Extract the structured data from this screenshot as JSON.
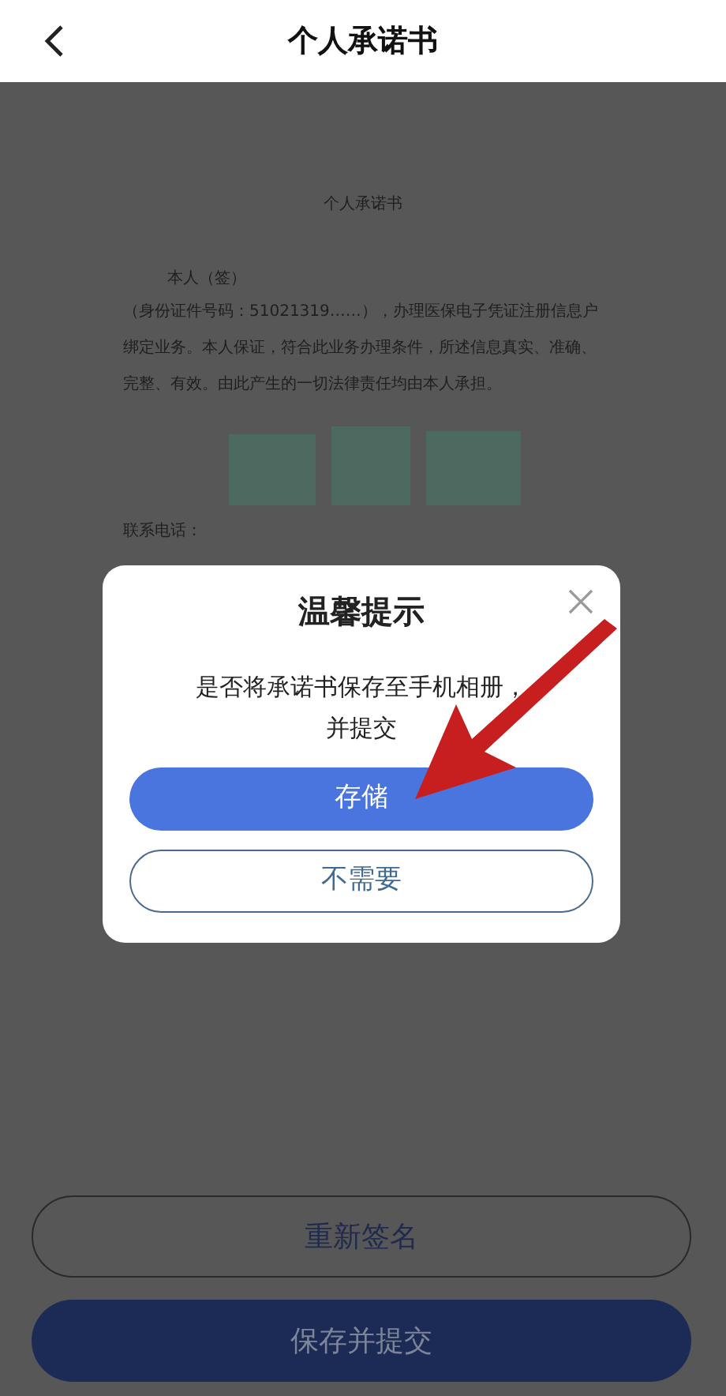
{
  "header": {
    "title": "个人承诺书"
  },
  "document": {
    "title": "个人承诺书",
    "signer": "本人（签）",
    "paragraph": "（身份证件号码：51021319……），办理医保电子凭证注册信息户绑定业务。本人保证，符合此业务办理条件，所述信息真实、准确、完整、有效。由此产生的一切法律责任均由本人承担。",
    "phone_label": "联系电话："
  },
  "dialog": {
    "title": "温馨提示",
    "message": "是否将承诺书保存至手机相册，并提交",
    "buttons": [
      {
        "label": "存储",
        "kind": "primary"
      },
      {
        "label": "不需要",
        "kind": "outline"
      }
    ]
  },
  "footer": {
    "buttons": [
      {
        "label": "重新签名",
        "kind": "outline"
      },
      {
        "label": "保存并提交",
        "kind": "primary"
      }
    ]
  }
}
